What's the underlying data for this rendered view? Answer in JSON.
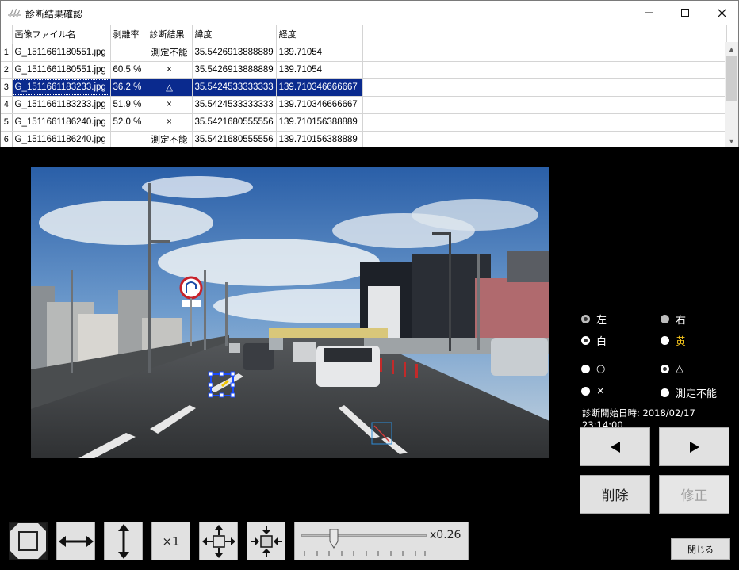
{
  "window": {
    "title": "診断結果確認",
    "min_icon": "minimize-icon",
    "max_icon": "maximize-icon",
    "close_icon": "close-icon"
  },
  "grid": {
    "columns": [
      "画像ファイル名",
      "剥離率",
      "診断結果",
      "緯度",
      "経度"
    ],
    "rows": [
      {
        "n": "1",
        "file": "G_1511661180551.jpg",
        "rate": "",
        "result": "測定不能",
        "lat": "35.5426913888889",
        "lon": "139.71054"
      },
      {
        "n": "2",
        "file": "G_1511661180551.jpg",
        "rate": "60.5 %",
        "result": "×",
        "lat": "35.5426913888889",
        "lon": "139.71054"
      },
      {
        "n": "3",
        "file": "G_1511661183233.jpg",
        "rate": "36.2 %",
        "result": "△",
        "lat": "35.5424533333333",
        "lon": "139.710346666667"
      },
      {
        "n": "4",
        "file": "G_1511661183233.jpg",
        "rate": "51.9 %",
        "result": "×",
        "lat": "35.5424533333333",
        "lon": "139.710346666667"
      },
      {
        "n": "5",
        "file": "G_1511661186240.jpg",
        "rate": "52.0 %",
        "result": "×",
        "lat": "35.5421680555556",
        "lon": "139.710156388889"
      },
      {
        "n": "6",
        "file": "G_1511661186240.jpg",
        "rate": "",
        "result": "測定不能",
        "lat": "35.5421680555556",
        "lon": "139.710156388889"
      }
    ],
    "selected_row": 3
  },
  "photo": {
    "description_icon": "road-photo",
    "road_sign_text": "ﾛﾀｰﾝ禁止"
  },
  "side": {
    "lane_left": "左",
    "lane_right": "右",
    "color_white": "白",
    "color_yellow": "黄",
    "result_good": "○",
    "result_fair": "△",
    "result_bad": "×",
    "result_unmeasurable": "測定不能",
    "diagnosis_start": "診断開始日時: 2018/02/17 23:14:00",
    "prev_icon": "triangle-left-icon",
    "next_icon": "triangle-right-icon",
    "delete_label": "削除",
    "modify_label": "修正",
    "close_label": "閉じる"
  },
  "toolbar": {
    "fit_icon": "fit-square-icon",
    "width_icon": "fit-width-icon",
    "height_icon": "fit-height-icon",
    "x1_label": "×1",
    "expand_icon": "expand-arrows-icon",
    "shrink_icon": "shrink-arrows-icon",
    "zoom_label": "x0.26",
    "zoom_value": 0.26
  },
  "colors": {
    "selection": "#0a2a8e",
    "yellow_text": "#f2c21b",
    "marker_blue": "#1a4bff"
  }
}
